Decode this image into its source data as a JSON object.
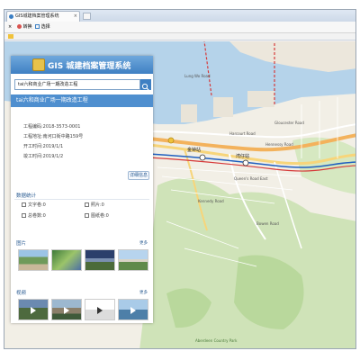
{
  "browser": {
    "tab_title": "GIS城建档案管理系统",
    "tab_close": "×",
    "toolbar": {
      "close_symbol": "×",
      "convert_label": "转换",
      "select_label": "选择"
    }
  },
  "app": {
    "logo_text": "GIS 城建档案管理系统"
  },
  "search": {
    "value": "tai六和商业广场一期改造工程"
  },
  "project": {
    "title": "tai六和商业广场一期改造工程",
    "code": "工程编码:2018-3573-0001",
    "address": "工程地址:南河口街中路159号",
    "start": "开工时间:2019/1/1",
    "end": "竣工时间:2019/1/2",
    "detail_button": "详细信息"
  },
  "stats": {
    "title": "数据统计",
    "doc_count": "文字卷:0",
    "photo_count": "照片:0",
    "total_count": "总卷数:0",
    "drawing_count": "图纸卷:0"
  },
  "photos": {
    "title": "图片",
    "more": "更多"
  },
  "videos": {
    "title": "视频",
    "more": "更多"
  },
  "map": {
    "labels": {
      "jinzhong": "金钟站",
      "wanchai": "湾仔站",
      "gloucester": "Gloucester Road",
      "hennessy": "Hennessy Road",
      "queens": "Queen's Road East",
      "harcourt": "Harcourt Road",
      "kennedy": "Kennedy Road",
      "aberdeen_park": "Aberdeen Country Park",
      "bowen": "Bowen Road",
      "lung_wo": "Lung Wo Road"
    }
  },
  "colors": {
    "accent": "#3f80c3",
    "header": "#4f8fcf",
    "water": "#b5d3ea",
    "land": "#f2efe6",
    "green": "#cfe3b8"
  }
}
